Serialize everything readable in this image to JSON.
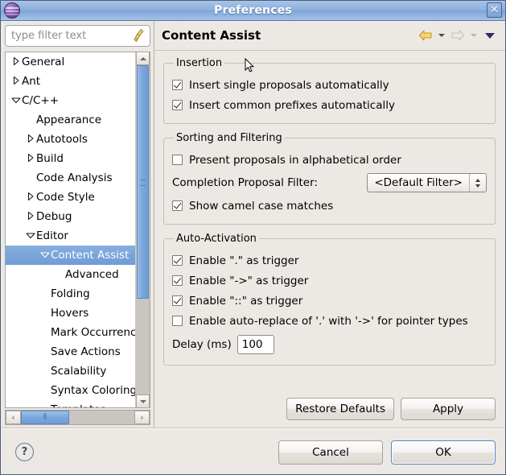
{
  "window": {
    "title": "Preferences",
    "icon": "eclipse-sphere-icon",
    "close_label": "✕"
  },
  "sidebar": {
    "filter": {
      "placeholder": "type filter text",
      "value": "",
      "clear_icon": "broom-icon"
    },
    "tree": [
      {
        "label": "General",
        "indent": 0,
        "twisty": "collapsed",
        "selected": false
      },
      {
        "label": "Ant",
        "indent": 0,
        "twisty": "collapsed",
        "selected": false
      },
      {
        "label": "C/C++",
        "indent": 0,
        "twisty": "expanded",
        "selected": false
      },
      {
        "label": "Appearance",
        "indent": 1,
        "twisty": "none",
        "selected": false
      },
      {
        "label": "Autotools",
        "indent": 1,
        "twisty": "collapsed",
        "selected": false
      },
      {
        "label": "Build",
        "indent": 1,
        "twisty": "collapsed",
        "selected": false
      },
      {
        "label": "Code Analysis",
        "indent": 1,
        "twisty": "none",
        "selected": false
      },
      {
        "label": "Code Style",
        "indent": 1,
        "twisty": "collapsed",
        "selected": false
      },
      {
        "label": "Debug",
        "indent": 1,
        "twisty": "collapsed",
        "selected": false
      },
      {
        "label": "Editor",
        "indent": 1,
        "twisty": "expanded",
        "selected": false
      },
      {
        "label": "Content Assist",
        "indent": 2,
        "twisty": "expanded",
        "selected": true
      },
      {
        "label": "Advanced",
        "indent": 3,
        "twisty": "none",
        "selected": false
      },
      {
        "label": "Folding",
        "indent": 2,
        "twisty": "none",
        "selected": false
      },
      {
        "label": "Hovers",
        "indent": 2,
        "twisty": "none",
        "selected": false
      },
      {
        "label": "Mark Occurrences",
        "indent": 2,
        "twisty": "none",
        "selected": false
      },
      {
        "label": "Save Actions",
        "indent": 2,
        "twisty": "none",
        "selected": false
      },
      {
        "label": "Scalability",
        "indent": 2,
        "twisty": "none",
        "selected": false
      },
      {
        "label": "Syntax Coloring",
        "indent": 2,
        "twisty": "none",
        "selected": false
      },
      {
        "label": "Templates",
        "indent": 2,
        "twisty": "none",
        "selected": false
      }
    ],
    "scrollbars": {
      "vertical_up_icon": "chevron-up-icon",
      "vertical_down_icon": "chevron-down-icon",
      "horizontal_left_icon": "chevron-left-icon",
      "horizontal_right_icon": "chevron-right-icon",
      "horizontal_left_label": "‹",
      "horizontal_right_label": "›",
      "thumb_grip": "⦀"
    }
  },
  "page": {
    "title": "Content Assist",
    "nav": {
      "back_icon": "back-arrow-icon",
      "back_menu_icon": "chevron-down-icon",
      "forward_icon": "forward-arrow-icon",
      "forward_menu_icon": "chevron-down-icon",
      "menu_icon": "dropdown-triangle-icon"
    },
    "groups": [
      {
        "legend": "Insertion",
        "checkboxes": [
          {
            "label": "Insert single proposals automatically",
            "checked": true
          },
          {
            "label": "Insert common prefixes automatically",
            "checked": true
          }
        ]
      },
      {
        "legend": "Sorting and Filtering",
        "checkbox_top": {
          "label": "Present proposals in alphabetical order",
          "checked": false
        },
        "combo": {
          "label": "Completion Proposal Filter:",
          "value": "<Default Filter>"
        },
        "checkbox_bottom": {
          "label": "Show camel case matches",
          "checked": true
        }
      },
      {
        "legend": "Auto-Activation",
        "checkboxes": [
          {
            "label": "Enable \".\" as trigger",
            "checked": true
          },
          {
            "label": "Enable \"->\" as trigger",
            "checked": true
          },
          {
            "label": "Enable \"::\" as trigger",
            "checked": true
          },
          {
            "label": "Enable auto-replace of '.' with '->' for pointer types",
            "checked": false
          }
        ],
        "delay": {
          "label": "Delay (ms)",
          "value": "100"
        }
      }
    ]
  },
  "buttons": {
    "restore_defaults": "Restore Defaults",
    "apply": "Apply",
    "cancel": "Cancel",
    "ok": "OK",
    "help": "?"
  },
  "colors": {
    "title_gradient_top": "#a8c3e6",
    "title_gradient_bottom": "#7ea5d8",
    "selection_blue": "#7aa5da",
    "dialog_bg": "#ece9e4",
    "back_arrow_gold": "#f2c14a",
    "forward_arrow_grey": "#cdcac4",
    "menu_triangle": "#2c2a6e"
  }
}
